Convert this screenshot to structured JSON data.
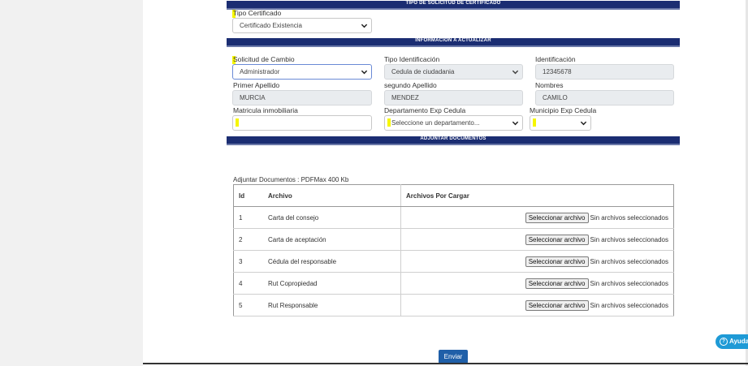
{
  "sections": {
    "tipo_solicitud": "TIPO DE SOLICITUD DE CERTIFICADO",
    "informacion": "INFORMACION A ACTUALIZAR",
    "adjuntar": "ADJUNTAR DOCUMENTOS"
  },
  "tipo_certificado": {
    "label": "Tipo Certificado",
    "value": "Certificado Existencia"
  },
  "form": {
    "solicitud_cambio": {
      "label": "Solicitud de Cambio",
      "value": "Administrador"
    },
    "tipo_identificacion": {
      "label": "Tipo Identificación",
      "value": "Cedula de ciudadania"
    },
    "identificacion": {
      "label": "Identificación",
      "value": "12345678"
    },
    "primer_apellido": {
      "label": "Primer Apellido",
      "value": "MURCIA"
    },
    "segundo_apellido": {
      "label": "segundo Apellido",
      "value": "MENDEZ"
    },
    "nombres": {
      "label": "Nombres",
      "value": "CAMILO"
    },
    "matricula": {
      "label": "Matricula inmobiliaria",
      "value": ""
    },
    "departamento": {
      "label": "Departamento Exp Cedula",
      "value": "Seleccione un departamento..."
    },
    "municipio": {
      "label": "Municipio Exp Cedula",
      "value": ""
    }
  },
  "documents": {
    "title": "Adjuntar Documentos : PDFMax 400 Kb",
    "headers": [
      "Id",
      "Archivo",
      "Archivos Por Cargar"
    ],
    "button_label": "Seleccionar archivo",
    "status_text": "Sin archivos seleccionados",
    "rows": [
      {
        "id": "1",
        "name": "Carta del consejo"
      },
      {
        "id": "2",
        "name": "Carta de aceptación"
      },
      {
        "id": "3",
        "name": "Cédula del responsable"
      },
      {
        "id": "4",
        "name": "Rut Copropiedad"
      },
      {
        "id": "5",
        "name": "Rut Responsable"
      }
    ]
  },
  "actions": {
    "send": "Enviar",
    "help": "Ayuda"
  },
  "icons": {
    "select_arrow": "chevron-down-icon",
    "help": "question-circle-icon"
  },
  "colors": {
    "section_bar": "#1b2d72",
    "send_button": "#1f5fa8",
    "help_button": "#1e9ad6",
    "required_marker": "#f6f600"
  }
}
